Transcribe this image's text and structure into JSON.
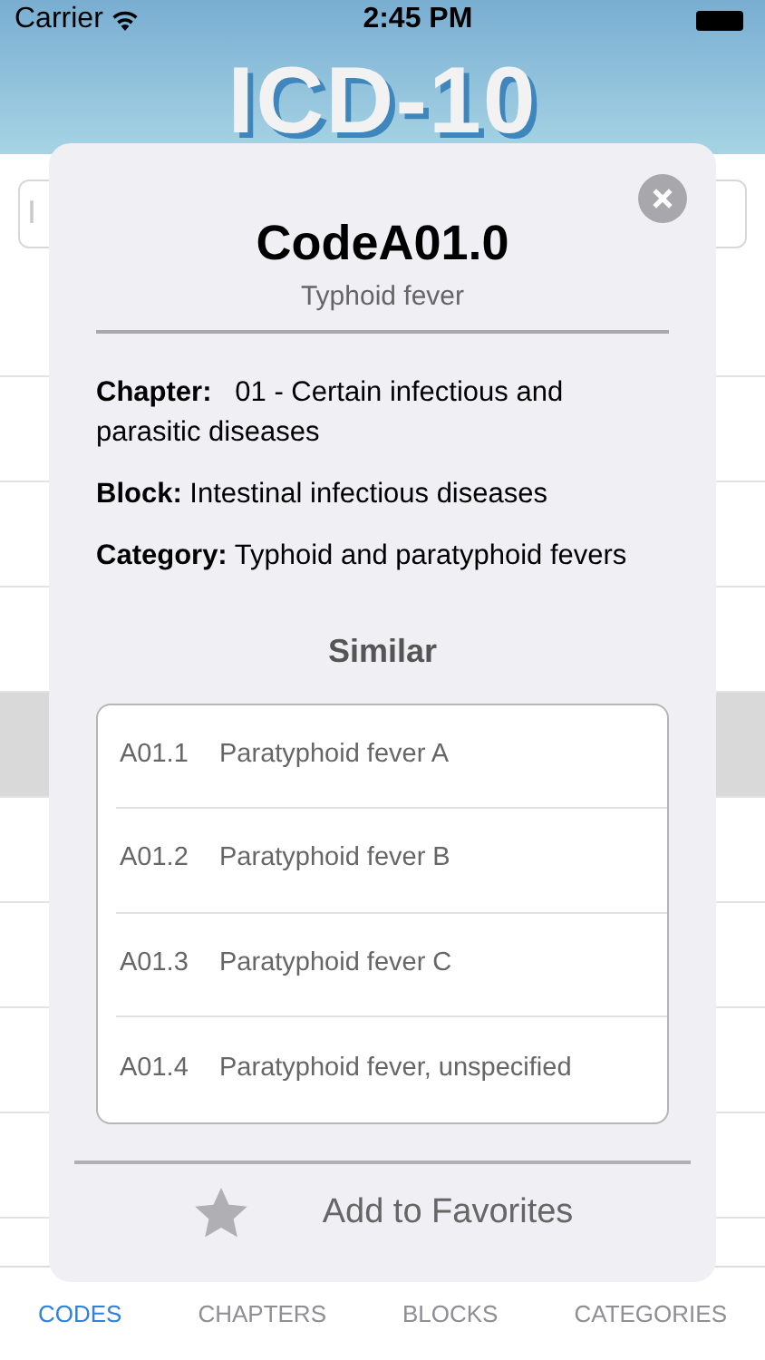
{
  "status_bar": {
    "carrier": "Carrier",
    "time": "2:45 PM"
  },
  "header": {
    "logo": "ICD-10"
  },
  "search": {
    "placeholder": "I"
  },
  "rows": [
    {
      "selected": false
    },
    {
      "selected": false
    },
    {
      "selected": false
    },
    {
      "selected": false
    },
    {
      "selected": true
    },
    {
      "selected": false
    },
    {
      "selected": false
    },
    {
      "selected": false
    },
    {
      "selected": false
    }
  ],
  "tabs": [
    {
      "label": "CODES",
      "selected": true
    },
    {
      "label": "CHAPTERS",
      "selected": false
    },
    {
      "label": "BLOCKS",
      "selected": false
    },
    {
      "label": "CATEGORIES",
      "selected": false
    }
  ],
  "dialog": {
    "title": "CodeA01.0",
    "subtitle": "Typhoid fever",
    "details": [
      "**Chapter:**   01 - Certain infectious and parasitic diseases",
      "**Block:** Intestinal infectious diseases",
      "**Category:** Typhoid and paratyphoid fevers"
    ],
    "similar_heading": "Similar",
    "similar": [
      {
        "code": "A01.1",
        "name": "Paratyphoid fever A"
      },
      {
        "code": "A01.2",
        "name": "Paratyphoid fever B"
      },
      {
        "code": "A01.3",
        "name": "Paratyphoid fever C"
      },
      {
        "code": "A01.4",
        "name": "Paratyphoid fever, unspecified"
      }
    ],
    "favorite_button": "Add to Favorites",
    "favorite": false
  }
}
